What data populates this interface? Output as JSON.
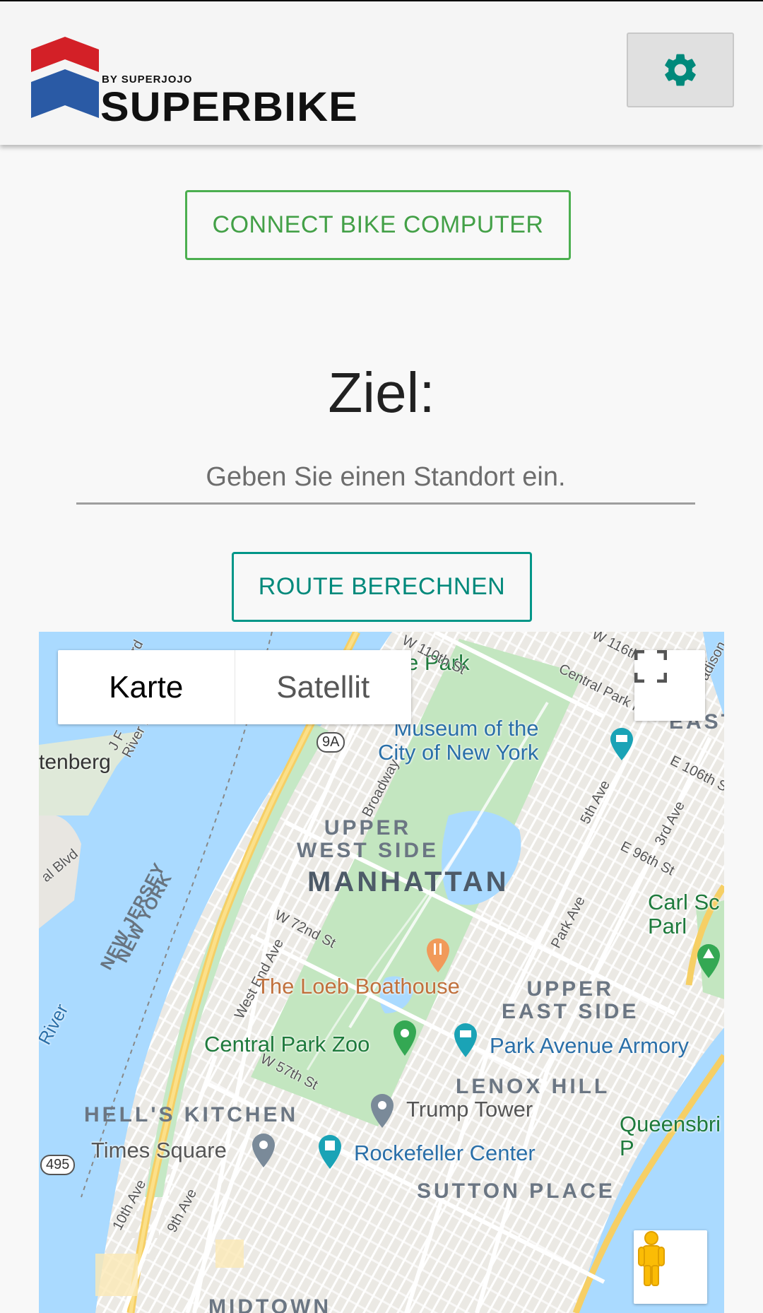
{
  "header": {
    "logo_tagline": "BY SUPERJOJO",
    "logo_text": "SUPERBIKE",
    "settings_icon": "gear-icon",
    "accent_color": "#00897b"
  },
  "connect_button": {
    "label": "CONNECT BIKE COMPUTER",
    "color": "#43a047"
  },
  "destination": {
    "title": "Ziel:",
    "placeholder": "Geben Sie einen Standort ein.",
    "value": ""
  },
  "route_button": {
    "label": "ROUTE BERECHNEN",
    "color": "#00897b"
  },
  "map": {
    "map_types": [
      "Karte",
      "Satellit"
    ],
    "selected_map_type": "Karte",
    "fullscreen_icon": "fullscreen-icon",
    "pegman_icon": "pegman-icon",
    "labels": {
      "park_partial": "e Park",
      "w110": "W 110th St",
      "w116": "W 116th",
      "madison": "adison",
      "central_park_n": "Central Park N",
      "museum": "Museum of the\nCity of New York",
      "east": "EAST",
      "e106": "E 106th S",
      "tenberg": "tenberg",
      "route_9a": "9A",
      "broadway": "Broadway",
      "fifth_ave": "5th Ave",
      "third_ave": "3rd Ave",
      "upper_west_side": "UPPER\nWEST SIDE",
      "e96": "E 96th St",
      "manhattan": "MANHATTAN",
      "carl_schurz": "Carl Sc\nParl",
      "park_ave": "Park Ave",
      "w72": "W 72nd St",
      "nj": "NEW JERSEY",
      "ny": "NEW YORK",
      "west_end": "West End Ave",
      "loeb": "The Loeb Boathouse",
      "upper_east_side": "UPPER\nEAST SIDE",
      "river": "River",
      "central_park_zoo": "Central Park Zoo",
      "park_avenue_armory": "Park Avenue Armory",
      "w57": "W 57th St",
      "lenox_hill": "LENOX HILL",
      "hells_kitchen": "HELL'S KITCHEN",
      "trump_tower": "Trump Tower",
      "queensbridge": "Queensbri\nP",
      "route_495": "495",
      "times_square": "Times Square",
      "rockefeller": "Rockefeller Center",
      "sutton_place": "SUTTON PLACE",
      "midtown": "MIDTOWN",
      "tenth_ave": "10th Ave",
      "ninth_ave": "9th Ave",
      "jf_river": "J F\nRiver R",
      "val_blvd": "al Blvd",
      "rd": "rd"
    }
  }
}
